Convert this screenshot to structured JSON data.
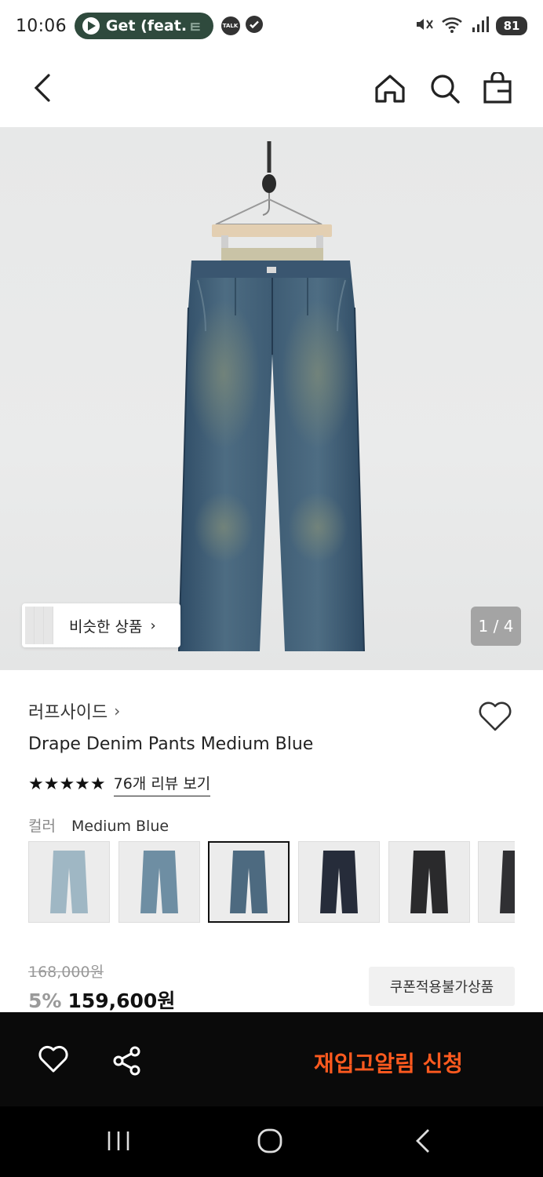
{
  "status_bar": {
    "time": "10:06",
    "media_text": "Get (feat.",
    "media_fade": "ㅌ",
    "talk_label": "TALK",
    "battery": "81"
  },
  "product": {
    "image_counter": "1 / 4",
    "similar_label": "비슷한 상품",
    "brand": "러프사이드",
    "title": "Drape Denim Pants Medium Blue",
    "stars": "★★★★★",
    "reviews_link": "76개 리뷰 보기",
    "color_label": "컬러",
    "color_value": "Medium Blue",
    "swatch_colors": [
      "#9fb7c4",
      "#6e8ea3",
      "#4d6a80",
      "#262c3a",
      "#2a2a2c",
      "#303033"
    ],
    "selected_swatch": 2,
    "original_price": "168,000원",
    "discount": "5%",
    "price": "159,600원",
    "coupon_label": "쿠폰적용불가상품"
  },
  "actions": {
    "restock_label": "재입고알림 신청",
    "accent_color": "#ff5a1f"
  },
  "icons": {
    "back": "chevron-left-icon",
    "home": "home-icon",
    "search": "search-icon",
    "bag": "shopping-bag-icon",
    "wish": "heart-icon",
    "share": "share-icon"
  }
}
